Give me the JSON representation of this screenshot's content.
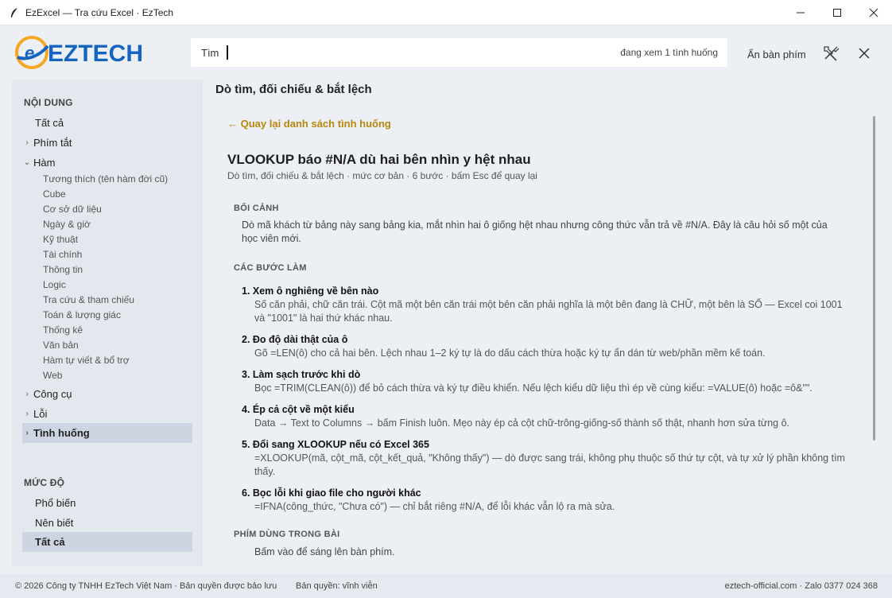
{
  "window": {
    "title": "EzExcel — Tra cứu Excel · EzTech"
  },
  "header": {
    "logo_text": "EZTECH",
    "search_label": "Tìm",
    "search_value": "",
    "search_status": "đang xem 1 tình huống",
    "hide_keyboard": "Ẩn bàn phím"
  },
  "sidebar": {
    "content_title": "NỘI DUNG",
    "items": {
      "all": "Tất cả",
      "shortcuts": "Phím tắt",
      "functions": "Hàm",
      "tools": "Công cụ",
      "errors": "Lỗi",
      "cases": "Tình huống"
    },
    "function_subitems": [
      "Tương thích (tên hàm đời cũ)",
      "Cube",
      "Cơ sở dữ liệu",
      "Ngày & giờ",
      "Kỹ thuật",
      "Tài chính",
      "Thông tin",
      "Logic",
      "Tra cứu & tham chiếu",
      "Toán & lượng giác",
      "Thống kê",
      "Văn bản",
      "Hàm tự viết & bổ trợ",
      "Web"
    ],
    "level_title": "MỨC ĐỘ",
    "levels": {
      "common": "Phổ biến",
      "should_know": "Nên biết",
      "all": "Tất cả"
    }
  },
  "main": {
    "category_title": "Dò tìm, đối chiếu & bắt lệch",
    "back_link": "←  Quay lại danh sách tình huống",
    "case_title": "VLOOKUP báo #N/A dù hai bên nhìn y hệt nhau",
    "case_meta": "Dò tìm, đối chiếu & bắt lệch · mức cơ bản · 6 bước · bấm Esc để quay lại",
    "context_heading": "BỐI CẢNH",
    "context_text": "Dò mã khách từ bảng này sang bảng kia, mắt nhìn hai ô giống hệt nhau nhưng công thức vẫn trả về #N/A. Đây là câu hỏi số một của học viên mới.",
    "steps_heading": "CÁC BƯỚC LÀM",
    "steps": [
      {
        "title": "1. Xem ô nghiêng về bên nào",
        "desc": "Số căn phải, chữ căn trái. Cột mã một bên căn trái một bên căn phải nghĩa là một bên đang là CHỮ, một bên là SỐ — Excel coi 1001 và \"1001\" là hai thứ khác nhau."
      },
      {
        "title": "2. Đo độ dài thật của ô",
        "desc": "Gõ =LEN(ô) cho cả hai bên. Lệch nhau 1–2 ký tự là do dấu cách thừa hoặc ký tự ẩn dán từ web/phần mềm kế toán."
      },
      {
        "title": "3. Làm sạch trước khi dò",
        "desc": "Bọc =TRIM(CLEAN(ô)) để bỏ cách thừa và ký tự điều khiển. Nếu lệch kiểu dữ liệu thì ép về cùng kiểu: =VALUE(ô) hoặc =ô&\"\"."
      },
      {
        "title": "4. Ép cả cột về một kiểu",
        "desc": "Data → Text to Columns → bấm Finish luôn. Mẹo này ép cả cột chữ-trông-giống-số thành số thật, nhanh hơn sửa từng ô."
      },
      {
        "title": "5. Đổi sang XLOOKUP nếu có Excel 365",
        "desc": "=XLOOKUP(mã, cột_mã, cột_kết_quả, \"Không thấy\") — dò được sang trái, không phụ thuộc số thứ tự cột, và tự xử lý phần không tìm thấy."
      },
      {
        "title": "6. Bọc lỗi khi giao file cho người khác",
        "desc": "=IFNA(công_thức, \"Chưa có\") — chỉ bắt riêng #N/A, để lỗi khác vẫn lộ ra mà sửa."
      }
    ],
    "keys_heading": "PHÍM DÙNG TRONG BÀI",
    "keys_hint": "Bấm vào để sáng lên bàn phím."
  },
  "footer": {
    "copyright": "© 2026 Công ty TNHH EzTech Việt Nam · Bản quyền được bảo lưu",
    "license": "Bản quyền: vĩnh viễn",
    "contact": "eztech-official.com  ·  Zalo 0377 024 368"
  },
  "colors": {
    "logo_blue": "#1565c0",
    "logo_orange": "#f5a623",
    "link_gold": "#b8860b",
    "selected_bg": "#cdd4e2"
  }
}
